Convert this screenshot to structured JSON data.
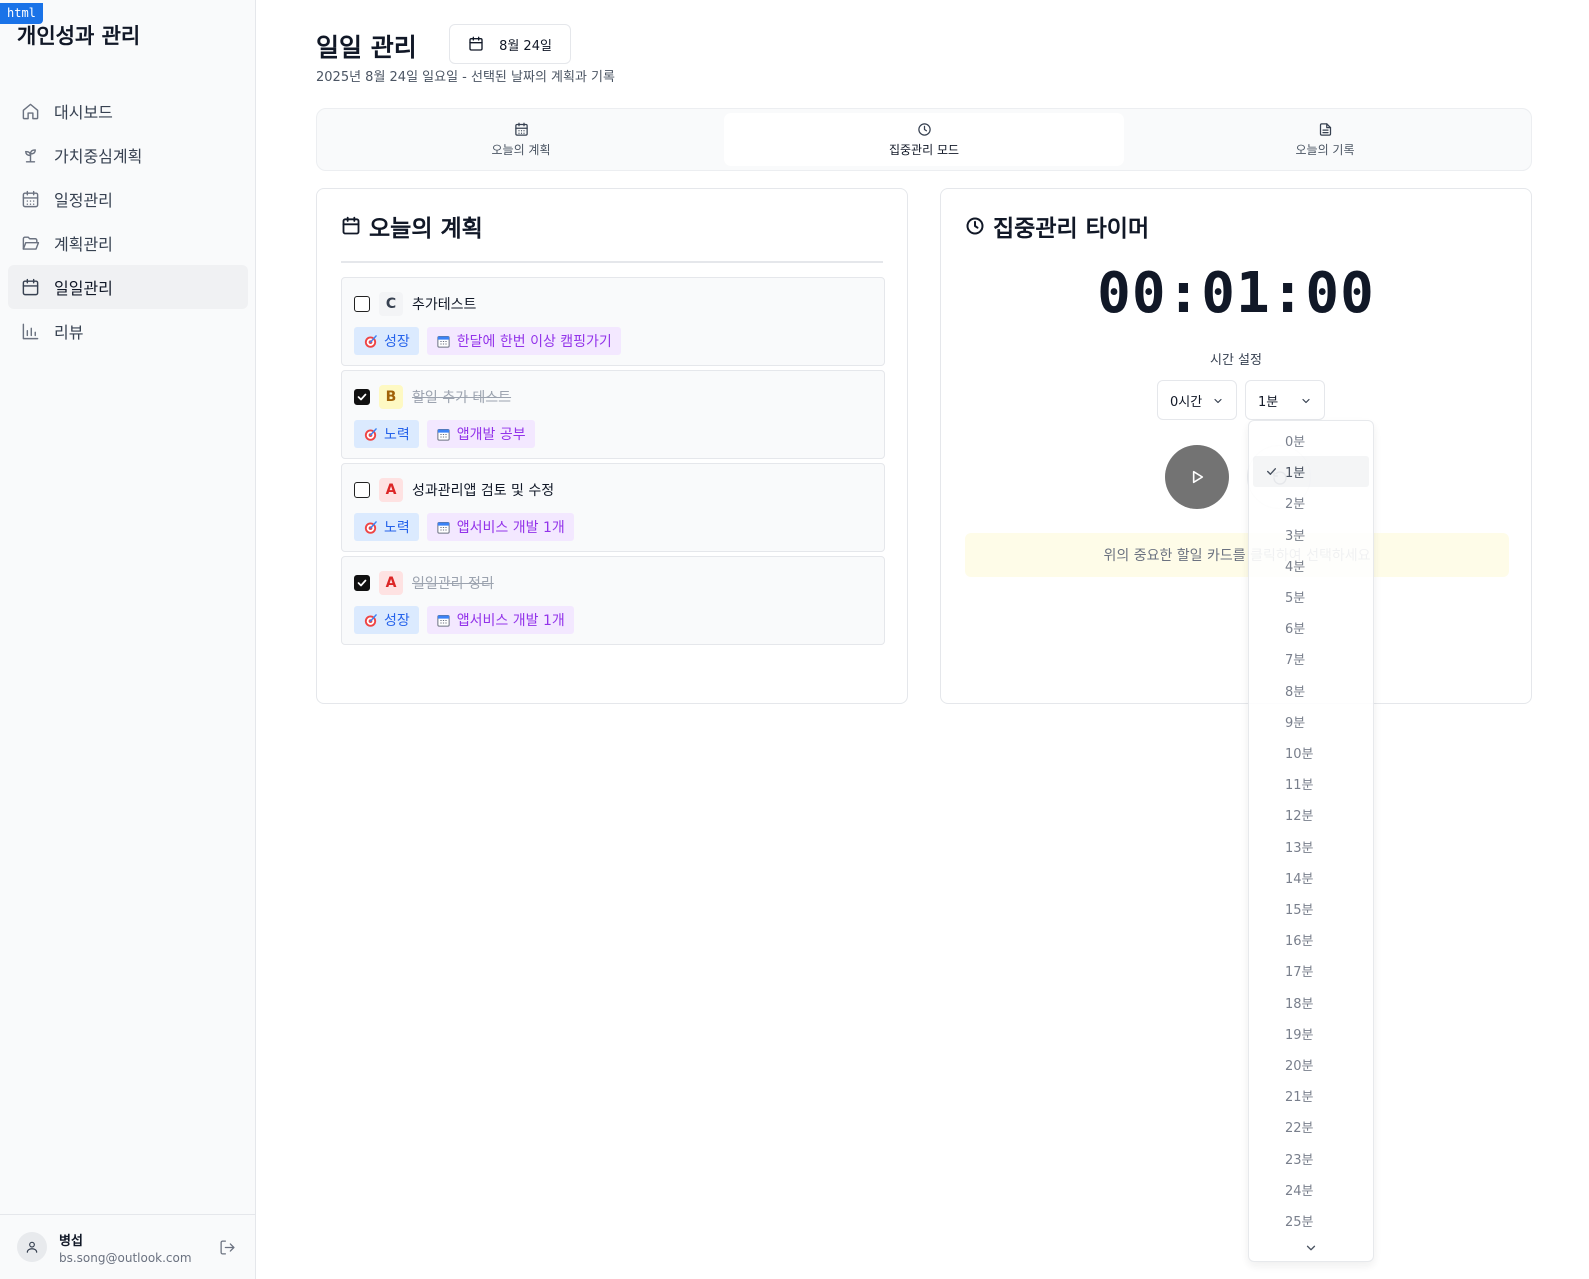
{
  "badge": "html",
  "sidebar": {
    "brand": "개인성과 관리",
    "items": [
      {
        "label": "대시보드",
        "icon": "home-icon"
      },
      {
        "label": "가치중심계획",
        "icon": "sprout-icon"
      },
      {
        "label": "일정관리",
        "icon": "calendar-days-icon"
      },
      {
        "label": "계획관리",
        "icon": "folder-open-icon"
      },
      {
        "label": "일일관리",
        "icon": "calendar-icon",
        "active": true
      },
      {
        "label": "리뷰",
        "icon": "bar-chart-icon"
      }
    ],
    "user": {
      "name": "병섭",
      "email": "bs.song@outlook.com"
    }
  },
  "header": {
    "title": "일일 관리",
    "date_button": "8월 24일",
    "subtitle": "2025년 8월 24일 일요일 - 선택된 날짜의 계획과 기록"
  },
  "tabs": [
    {
      "label": "오늘의 계획",
      "icon": "calendar-icon"
    },
    {
      "label": "집중관리 모드",
      "icon": "clock-icon",
      "active": true
    },
    {
      "label": "오늘의 기록",
      "icon": "file-text-icon"
    }
  ],
  "plan_card": {
    "title": "오늘의 계획",
    "tasks": [
      {
        "checked": false,
        "priority": "C",
        "title": "추가테스트",
        "value_tag": "성장",
        "plan_tag": "한달에 한번 이상 캠핑가기"
      },
      {
        "checked": true,
        "priority": "B",
        "title": "할일 추가 테스트",
        "value_tag": "노력",
        "plan_tag": "앱개발 공부"
      },
      {
        "checked": false,
        "priority": "A",
        "title": "성과관리앱 검토 및 수정",
        "value_tag": "노력",
        "plan_tag": "앱서비스 개발 1개"
      },
      {
        "checked": true,
        "priority": "A",
        "title": "일일관리 정리",
        "value_tag": "성장",
        "plan_tag": "앱서비스 개발 1개"
      }
    ]
  },
  "timer_card": {
    "title": "집중관리 타이머",
    "time": "00:01:00",
    "time_setting_label": "시간 설정",
    "hours_value": "0시간",
    "minutes_value": "1분",
    "hint": "위의 중요한 할일 카드를 클릭하여 선택하세요"
  },
  "minutes_dropdown": {
    "selected": "1분",
    "options": [
      "0분",
      "1분",
      "2분",
      "3분",
      "4분",
      "5분",
      "6분",
      "7분",
      "8분",
      "9분",
      "10분",
      "11분",
      "12분",
      "13분",
      "14분",
      "15분",
      "16분",
      "17분",
      "18분",
      "19분",
      "20분",
      "21분",
      "22분",
      "23분",
      "24분",
      "25분"
    ]
  },
  "colors": {
    "accent_blue": "#2563eb",
    "accent_purple": "#9333ea",
    "priority_a": "#dc2626",
    "priority_b": "#a16207",
    "hint_bg": "#fefce8"
  }
}
